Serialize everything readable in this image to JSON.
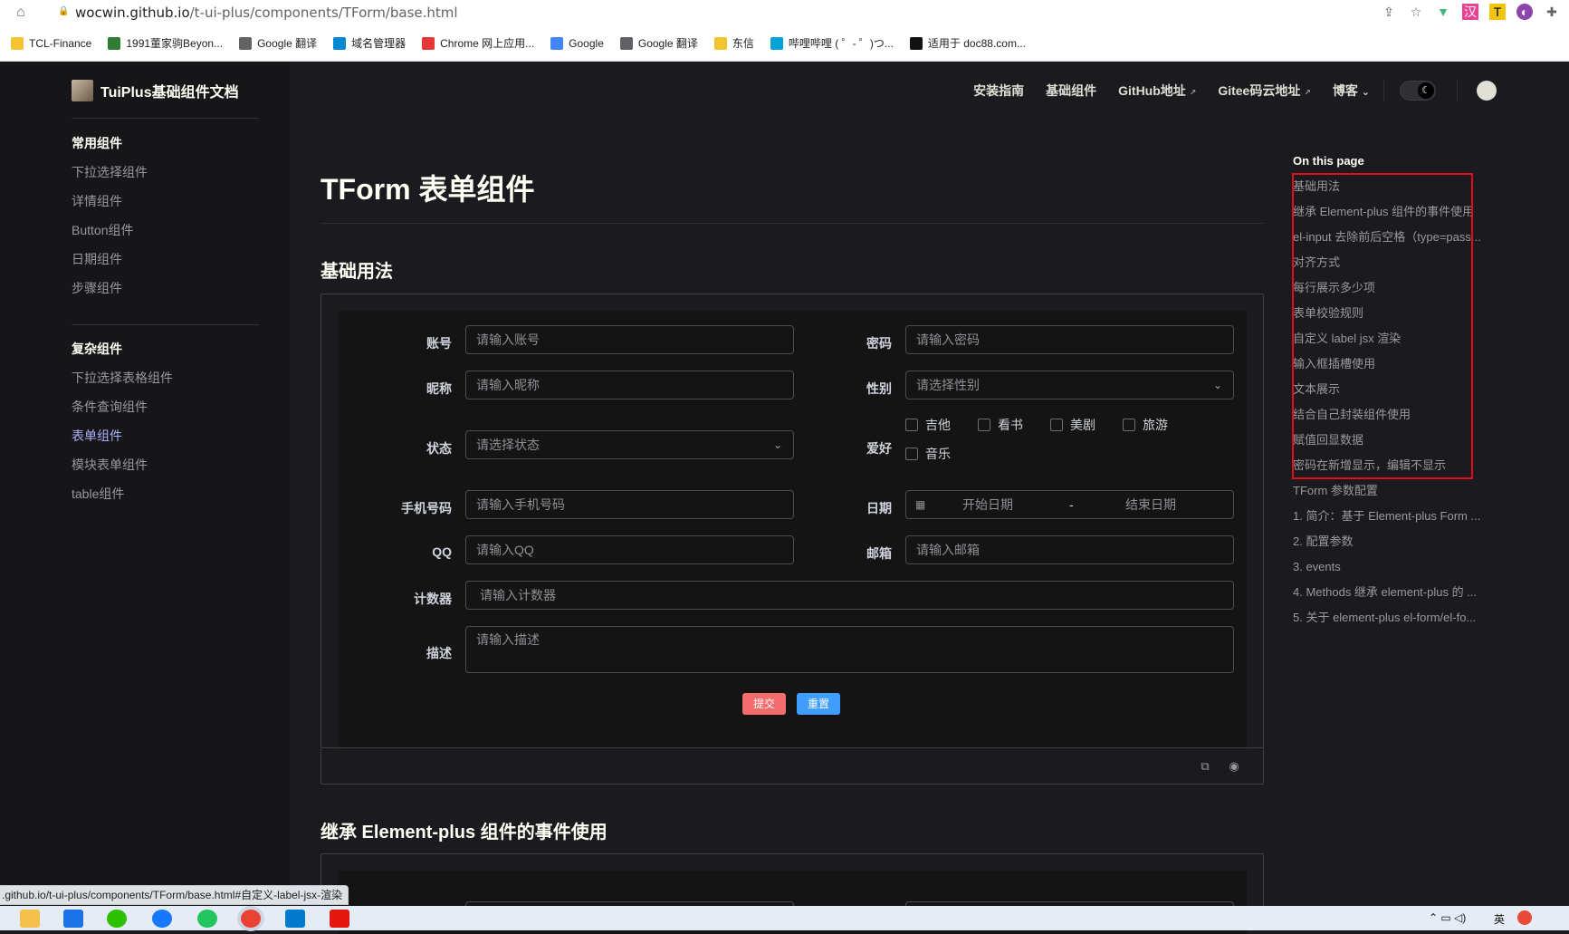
{
  "browser": {
    "url_host": "wocwin.github.io",
    "url_path": "/t-ui-plus/components/TForm/base.html",
    "bookmarks": [
      "TCL-Finance",
      "1991董家驹Beyon...",
      "Google 翻译",
      "域名管理器",
      "Chrome 网上应用...",
      "Google",
      "Google 翻译",
      "东信",
      "哔哩哔哩 ( ゜- ゜)つ...",
      "适用于 doc88.com..."
    ],
    "status_text": ".github.io/t-ui-plus/components/TForm/base.html#自定义-label-jsx-渲染"
  },
  "brand": {
    "title": "TuiPlus基础组件文档"
  },
  "nav": {
    "links": [
      "安装指南",
      "基础组件",
      "GitHub地址",
      "Gitee码云地址",
      "博客"
    ],
    "ext_mark": "↗",
    "dropdown": "⌄"
  },
  "sidebar": {
    "groups": [
      {
        "title": "常用组件",
        "items": [
          "下拉选择组件",
          "详情组件",
          "Button组件",
          "日期组件",
          "步骤组件"
        ]
      },
      {
        "title": "复杂组件",
        "items": [
          "下拉选择表格组件",
          "条件查询组件",
          "表单组件",
          "模块表单组件",
          "table组件"
        ]
      }
    ],
    "active": "表单组件"
  },
  "page": {
    "title": "TForm 表单组件",
    "section1": "基础用法",
    "section2": "继承 Element-plus 组件的事件使用"
  },
  "form": {
    "account_label": "账号",
    "account_ph": "请输入账号",
    "password_label": "密码",
    "password_ph": "请输入密码",
    "nickname_label": "昵称",
    "nickname_ph": "请输入昵称",
    "gender_label": "性别",
    "gender_ph": "请选择性别",
    "status_label": "状态",
    "status_ph": "请选择状态",
    "hobby_label": "爱好",
    "hobbies": [
      "吉他",
      "看书",
      "美剧",
      "旅游",
      "音乐"
    ],
    "phone_label": "手机号码",
    "phone_ph": "请输入手机号码",
    "date_label": "日期",
    "date_start": "开始日期",
    "date_sep": "-",
    "date_end": "结束日期",
    "qq_label": "QQ",
    "qq_ph": "请输入QQ",
    "email_label": "邮箱",
    "email_ph": "请输入邮箱",
    "counter_label": "计数器",
    "counter_ph": "请输入计数器",
    "desc_label": "描述",
    "desc_ph": "请输入描述",
    "submit": "提交",
    "reset": "重置"
  },
  "toc": {
    "title": "On this page",
    "items": [
      "基础用法",
      "继承 Element-plus 组件的事件使用",
      "el-input 去除前后空格（type=pass...",
      "对齐方式",
      "每行展示多少项",
      "表单校验规则",
      "自定义 label jsx 渲染",
      "输入框插槽使用",
      "文本展示",
      "结合自己封装组件使用",
      "赋值回显数据",
      "密码在新增显示，编辑不显示",
      "TForm 参数配置",
      "1. 简介：基于 Element-plus Form ...",
      "2. 配置参数",
      "3. events",
      "4. Methods 继承 element-plus 的 ...",
      "5. 关于 element-plus el-form/el-fo..."
    ]
  },
  "taskbar": {
    "ime": "英"
  },
  "colors": {
    "accent": "#a8b1ff",
    "submit": "#f56c6c",
    "reset": "#409eff",
    "highlight_box": "#e0101a"
  }
}
